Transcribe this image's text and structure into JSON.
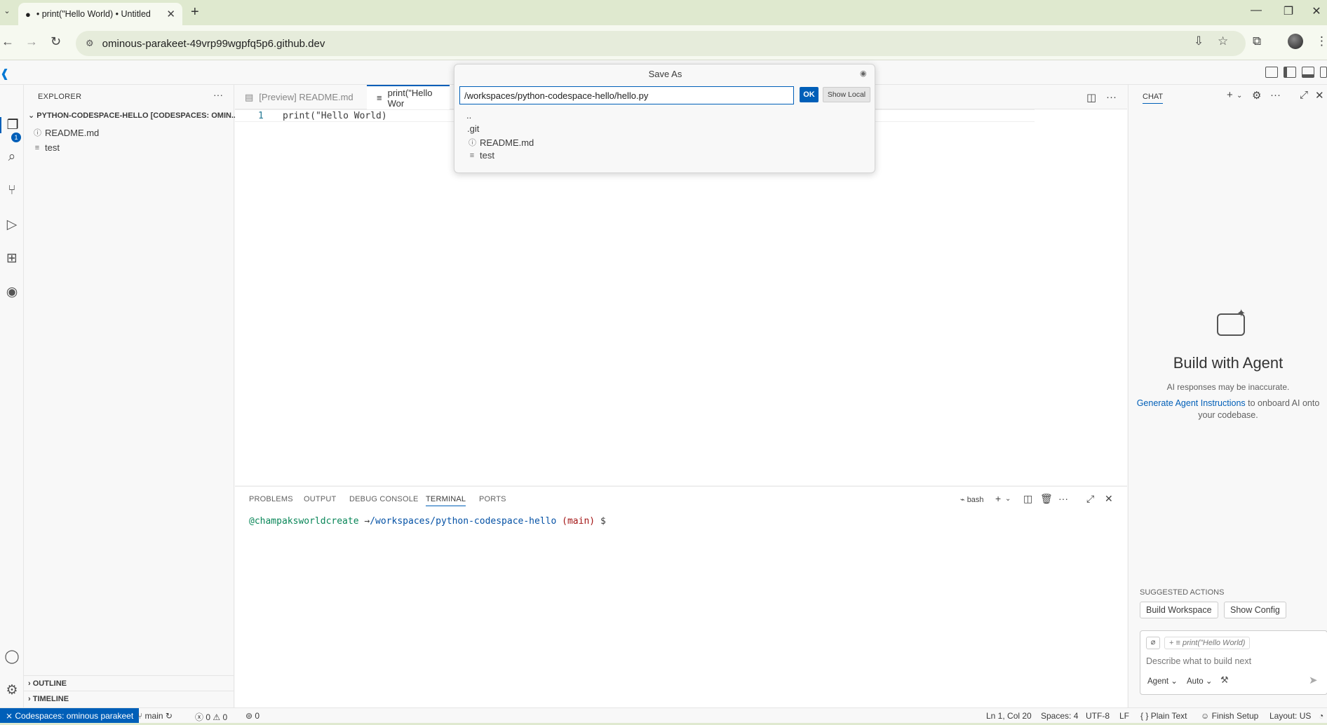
{
  "browser": {
    "tab_title": "• print(\"Hello World) • Untitled",
    "url": "ominous-parakeet-49vrp99wgpfq5p6.github.dev",
    "new_tab_symbol": "+",
    "close_symbol": "✕"
  },
  "sidebar": {
    "title": "EXPLORER",
    "root": "PYTHON-CODESPACE-HELLO [CODESPACES: OMIN...",
    "files": [
      "README.md",
      "test"
    ],
    "outline_label": "OUTLINE",
    "timeline_label": "TIMELINE",
    "badge_count": "1"
  },
  "editor": {
    "tabs": [
      {
        "label": "[Preview] README.md"
      },
      {
        "label": "print(\"Hello Wor"
      }
    ],
    "line_number": "1",
    "code_line": "print(\"Hello World)"
  },
  "save_as": {
    "title": "Save As",
    "input_value": "/workspaces/python-codespace-hello/hello.py",
    "ok_label": "OK",
    "show_local_label": "Show Local",
    "items": [
      "..",
      ".git",
      "README.md",
      "test"
    ]
  },
  "panel": {
    "tabs": [
      "PROBLEMS",
      "OUTPUT",
      "DEBUG CONSOLE",
      "TERMINAL",
      "PORTS"
    ],
    "active_tab": "TERMINAL",
    "shell_label": "bash",
    "prompt_user": "@champaksworldcreate",
    "prompt_arrow": " →",
    "prompt_path": "/workspaces/python-codespace-hello",
    "prompt_branch": "(main)",
    "prompt_symbol": "$"
  },
  "chat": {
    "title": "CHAT",
    "heading": "Build with Agent",
    "subtitle": "AI responses may be inaccurate.",
    "link_text": "Generate Agent Instructions",
    "link_suffix": " to onboard AI onto your codebase.",
    "suggested_heading": "SUGGESTED ACTIONS",
    "suggested_actions": [
      "Build Workspace",
      "Show Config"
    ],
    "context_chip": "print(\"Hello World)",
    "input_placeholder": "Describe what to build next",
    "mode": "Agent",
    "model": "Auto"
  },
  "status": {
    "remote": "Codespaces: ominous parakeet",
    "branch": "main",
    "errors": "0",
    "warnings": "0",
    "ports": "0",
    "position": "Ln 1, Col 20",
    "spaces": "Spaces: 4",
    "encoding": "UTF-8",
    "eol": "LF",
    "language": "Plain Text",
    "finish_setup": "Finish Setup",
    "layout": "Layout: US"
  },
  "colors": {
    "accent": "#005fb8",
    "chrome_bg": "#dfe9cf",
    "terminal_user": "#098658",
    "terminal_path": "#0451a5",
    "terminal_branch": "#a31515"
  }
}
